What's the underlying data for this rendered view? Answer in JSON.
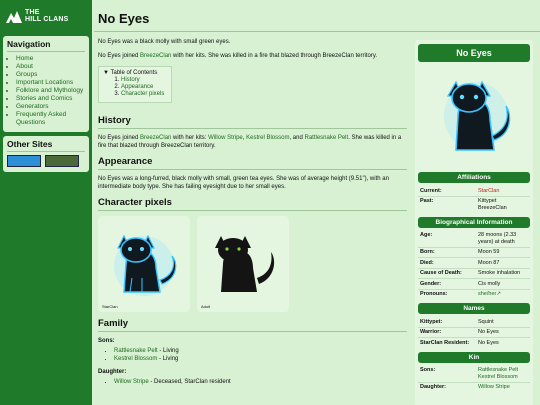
{
  "site": {
    "logo_line1": "THE",
    "logo_line2": "HILL CLANS"
  },
  "nav": {
    "title": "Navigation",
    "items": [
      "Home",
      "About",
      "Groups",
      "Important Locations",
      "Folklore and Mythology",
      "Stories and Comics",
      "Generators",
      "Frequently Asked Questions"
    ]
  },
  "other_sites": {
    "title": "Other Sites"
  },
  "page": {
    "title": "No Eyes",
    "intro": "No Eyes was a black molly with small green eyes.",
    "intro2_pre": "No Eyes joined ",
    "intro2_link": "BreezeClan",
    "intro2_post": " with her kits. She was killed in a fire that blazed through BreezeClan territory.",
    "toc": {
      "title": "Table of Contents",
      "items": [
        "History",
        "Appearance",
        "Character pixels"
      ]
    },
    "history": {
      "heading": "History",
      "pre": "No Eyes joined ",
      "link1": "BreezeClan",
      "mid1": " with her kits: ",
      "link2": "Willow Stripe",
      "sep1": ", ",
      "link3": "Kestrel Blossom",
      "sep2": ", and ",
      "link4": "Rattlesnake Pelt",
      "post": ". She was killed in a fire that blazed through BreezeClan territory."
    },
    "appearance": {
      "heading": "Appearance",
      "text": "No Eyes was a long-furred, black molly with small, green tea eyes. She was of average height (9.51\"), with an intermediate body type. She has failing eyesight due to her small eyes."
    },
    "pixels": {
      "heading": "Character pixels",
      "cards": [
        {
          "caption": "StarClan"
        },
        {
          "caption": "Adult"
        }
      ]
    },
    "family": {
      "heading": "Family",
      "sons_label": "Sons:",
      "sons": [
        {
          "name": "Rattlesnake Pelt",
          "status": " - Living"
        },
        {
          "name": "Kestrel Blossom",
          "status": " - Living"
        }
      ],
      "daughter_label": "Daughter:",
      "daughters": [
        {
          "name": "Willow Stripe",
          "status": " - Deceased, StarClan resident"
        }
      ]
    }
  },
  "infobox": {
    "name": "No Eyes",
    "affiliations": {
      "heading": "Affiliations",
      "current_label": "Current:",
      "current": "StarClan",
      "past_label": "Past:",
      "past": "Kittypet\nBreezeClan"
    },
    "bio": {
      "heading": "Biographical Information",
      "age_label": "Age:",
      "age": "28 moons (2.33 years) at death",
      "born_label": "Born:",
      "born": "Moon 59",
      "died_label": "Died:",
      "died": "Moon 87",
      "cause_label": "Cause of Death:",
      "cause": "Smoke inhalation",
      "gender_label": "Gender:",
      "gender": "Cis molly",
      "pronouns_label": "Pronouns:",
      "pronouns": "she/her"
    },
    "names": {
      "heading": "Names",
      "kittypet_label": "Kittypet:",
      "kittypet": "Squint",
      "warrior_label": "Warrior:",
      "warrior": "No Eyes",
      "starclan_label": "StarClan Resident:",
      "starclan": "No Eyes"
    },
    "kin": {
      "heading": "Kin",
      "sons_label": "Sons:",
      "sons": "Rattlesnake Pelt\nKestrel Blossom",
      "daughter_label": "Daughter:",
      "daughter": "Willow Stripe"
    }
  },
  "colors": {
    "sidebar": "#1f7a2a",
    "page_bg": "#d7f1d2",
    "link": "#1f6b1f",
    "starclan": "#c42222"
  }
}
